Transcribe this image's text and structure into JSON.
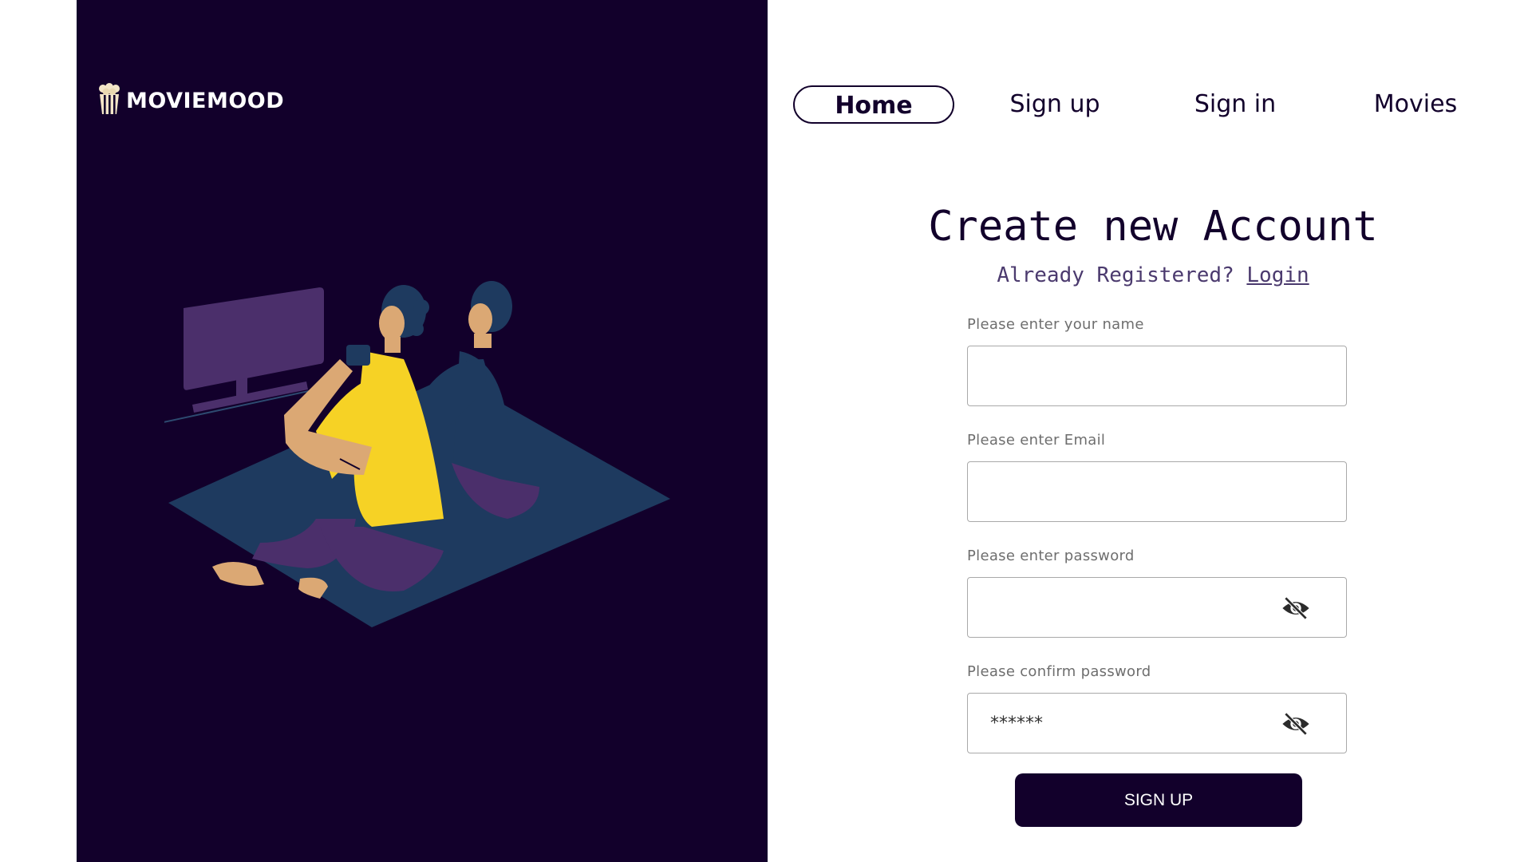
{
  "brand": {
    "name": "MOVIEMOOD",
    "logo_icon": "popcorn-icon"
  },
  "nav": {
    "items": [
      {
        "label": "Home",
        "active": true
      },
      {
        "label": "Sign up",
        "active": false
      },
      {
        "label": "Sign in",
        "active": false
      },
      {
        "label": "Movies",
        "active": false
      }
    ]
  },
  "form": {
    "title": "Create new Account",
    "subtitle_prefix": "Already Registered? ",
    "login_link": "Login",
    "name_label": "Please enter your name",
    "name_value": "",
    "email_label": "Please enter Email",
    "email_value": "",
    "password_label": "Please enter password",
    "password_value": "",
    "confirm_label": "Please confirm password",
    "confirm_value": "******",
    "visibility_icon": "eye-off-icon",
    "submit_label": "SIGN UP"
  },
  "colors": {
    "primary": "#12002b",
    "tv": "#4b2f6b",
    "rug": "#1e3a5f",
    "shirt_yellow": "#f6d225",
    "skin": "#dba874",
    "pants": "#4b2f6b",
    "shirt_navy": "#1e3a5f",
    "hair": "#1e3a5f"
  }
}
